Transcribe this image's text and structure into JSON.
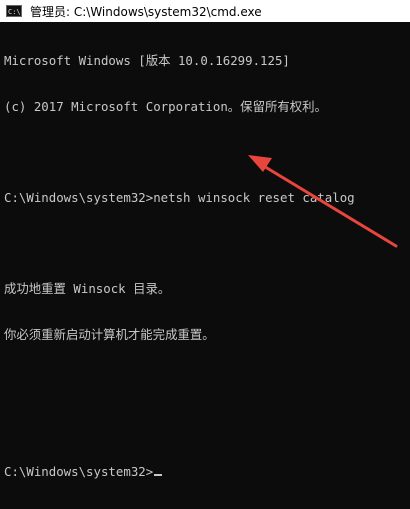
{
  "window": {
    "title": "管理员: C:\\Windows\\system32\\cmd.exe",
    "icon_label": "C:\\",
    "icon": "console-app-icon"
  },
  "console": {
    "lines": [
      "Microsoft Windows [版本 10.0.16299.125]",
      "(c) 2017 Microsoft Corporation。保留所有权利。",
      "",
      "C:\\Windows\\system32>netsh winsock reset catalog",
      "",
      "成功地重置 Winsock 目录。",
      "你必须重新启动计算机才能完成重置。",
      "",
      "",
      "C:\\Windows\\system32>"
    ]
  },
  "colors": {
    "background": "#0c0c0c",
    "text": "#c8c8c8",
    "arrow": "#e8453c",
    "titlebar": "#ffffff"
  }
}
